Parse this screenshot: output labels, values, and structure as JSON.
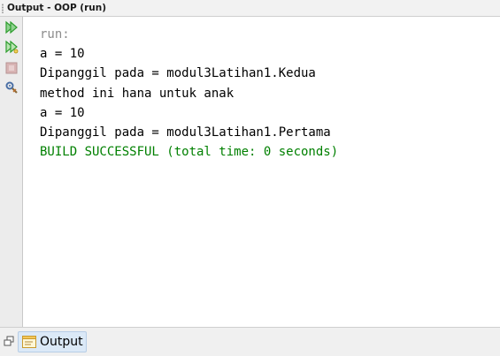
{
  "window": {
    "title": "Output - OOP (run)"
  },
  "toolbar": {
    "buttons": [
      {
        "icon": "rerun-icon",
        "color": "#2e9e2e"
      },
      {
        "icon": "rerun-with-options-icon",
        "color": "#2e9e2e"
      },
      {
        "icon": "stop-icon",
        "color": "#c9a3a3"
      },
      {
        "icon": "settings-icon",
        "color": "#4a6fa5"
      }
    ]
  },
  "console": {
    "lines": [
      {
        "text": "run:",
        "kind": "muted"
      },
      {
        "text": "a = 10",
        "kind": "normal"
      },
      {
        "text": "Dipanggil pada = modul3Latihan1.Kedua",
        "kind": "normal"
      },
      {
        "text": "method ini hana untuk anak",
        "kind": "normal"
      },
      {
        "text": "a = 10",
        "kind": "normal"
      },
      {
        "text": "Dipanggil pada = modul3Latihan1.Pertama",
        "kind": "normal"
      },
      {
        "text": "BUILD SUCCESSFUL (total time: 0 seconds)",
        "kind": "success"
      }
    ],
    "colors": {
      "muted": "#8c8c8c",
      "normal": "#000000",
      "success": "#008000"
    }
  },
  "bottom_tab": {
    "label": "Output",
    "icon": "output-window-icon"
  }
}
